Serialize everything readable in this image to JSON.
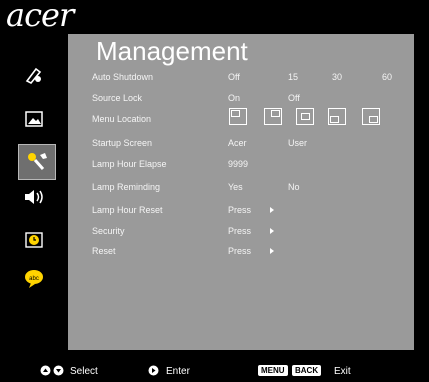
{
  "brand": "acer",
  "title": "Management",
  "sidebar": [
    {
      "icon": "color-icon"
    },
    {
      "icon": "image-icon"
    },
    {
      "icon": "management-icon",
      "selected": true
    },
    {
      "icon": "audio-icon"
    },
    {
      "icon": "timer-icon"
    },
    {
      "icon": "language-icon"
    }
  ],
  "rows": [
    {
      "label": "Auto Shutdown",
      "values": [
        "Off",
        "15",
        "30",
        "60"
      ]
    },
    {
      "label": "Source Lock",
      "values": [
        "On",
        "Off"
      ]
    },
    {
      "label": "Menu Location"
    },
    {
      "label": "Startup Screen",
      "values": [
        "Acer",
        "User"
      ]
    },
    {
      "label": "Lamp Hour Elapse",
      "values": [
        "9999"
      ]
    },
    {
      "label": "Lamp Reminding",
      "values": [
        "Yes",
        "No"
      ]
    },
    {
      "label": "Lamp Hour Reset",
      "action": "Press"
    },
    {
      "label": "Security",
      "action": "Press"
    },
    {
      "label": "Reset",
      "action": "Press"
    }
  ],
  "footer": {
    "select_label": "Select",
    "enter_label": "Enter",
    "menu_badge": "MENU",
    "back_badge": "BACK",
    "exit_label": "Exit"
  },
  "colors": {
    "panel": "#9a9a9a",
    "background": "#000000",
    "text": "#ffffff"
  }
}
